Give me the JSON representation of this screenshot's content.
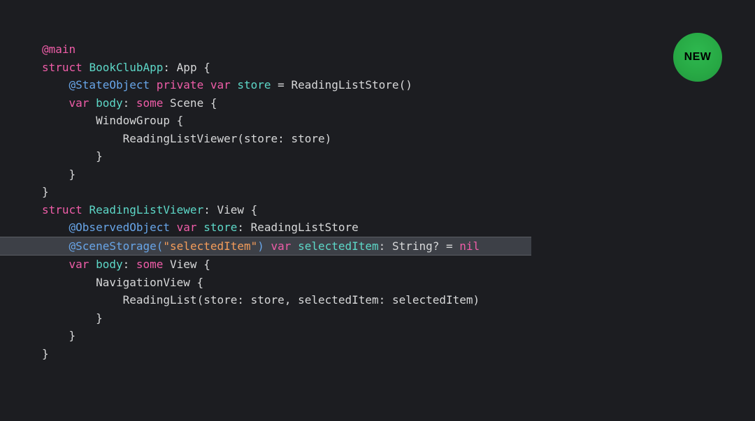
{
  "badge": {
    "label": "NEW"
  },
  "code": {
    "l00": {
      "t0": "@main"
    },
    "l01": {
      "t0": "struct ",
      "t1": "BookClubApp",
      "t2": ": ",
      "t3": "App",
      "t4": " {"
    },
    "l02": {
      "t0": "    ",
      "t1": "@StateObject ",
      "t2": "private ",
      "t3": "var ",
      "t4": "store",
      "t5": " = ",
      "t6": "ReadingListStore",
      "t7": "()"
    },
    "l03": {
      "t0": ""
    },
    "l04": {
      "t0": "    ",
      "t1": "var ",
      "t2": "body",
      "t3": ": ",
      "t4": "some ",
      "t5": "Scene",
      "t6": " {"
    },
    "l05": {
      "t0": "        ",
      "t1": "WindowGroup",
      "t2": " {"
    },
    "l06": {
      "t0": "            ",
      "t1": "ReadingListViewer",
      "t2": "(",
      "t3": "store",
      "t4": ": ",
      "t5": "store",
      "t6": ")"
    },
    "l07": {
      "t0": "        }"
    },
    "l08": {
      "t0": "    }"
    },
    "l09": {
      "t0": "}"
    },
    "l10": {
      "t0": ""
    },
    "l11": {
      "t0": "struct ",
      "t1": "ReadingListViewer",
      "t2": ": ",
      "t3": "View",
      "t4": " {"
    },
    "l12": {
      "t0": "    ",
      "t1": "@ObservedObject ",
      "t2": "var ",
      "t3": "store",
      "t4": ": ",
      "t5": "ReadingListStore"
    },
    "l13": {
      "t0": "    ",
      "t1": "@SceneStorage",
      "t2": "(",
      "t3": "\"selectedItem\"",
      "t4": ")",
      "t5": " var ",
      "t6": "selectedItem",
      "t7": ": ",
      "t8": "String",
      "t9": "? = ",
      "t10": "nil"
    },
    "l14": {
      "t0": ""
    },
    "l15": {
      "t0": "    ",
      "t1": "var ",
      "t2": "body",
      "t3": ": ",
      "t4": "some ",
      "t5": "View",
      "t6": " {"
    },
    "l16": {
      "t0": "        ",
      "t1": "NavigationView",
      "t2": " {"
    },
    "l17": {
      "t0": "            ",
      "t1": "ReadingList",
      "t2": "(",
      "t3": "store",
      "t4": ": ",
      "t5": "store",
      "t6": ", ",
      "t7": "selectedItem",
      "t8": ": ",
      "t9": "selectedItem",
      "t10": ")"
    },
    "l18": {
      "t0": "        }"
    },
    "l19": {
      "t0": "    }"
    },
    "l20": {
      "t0": "}"
    }
  }
}
